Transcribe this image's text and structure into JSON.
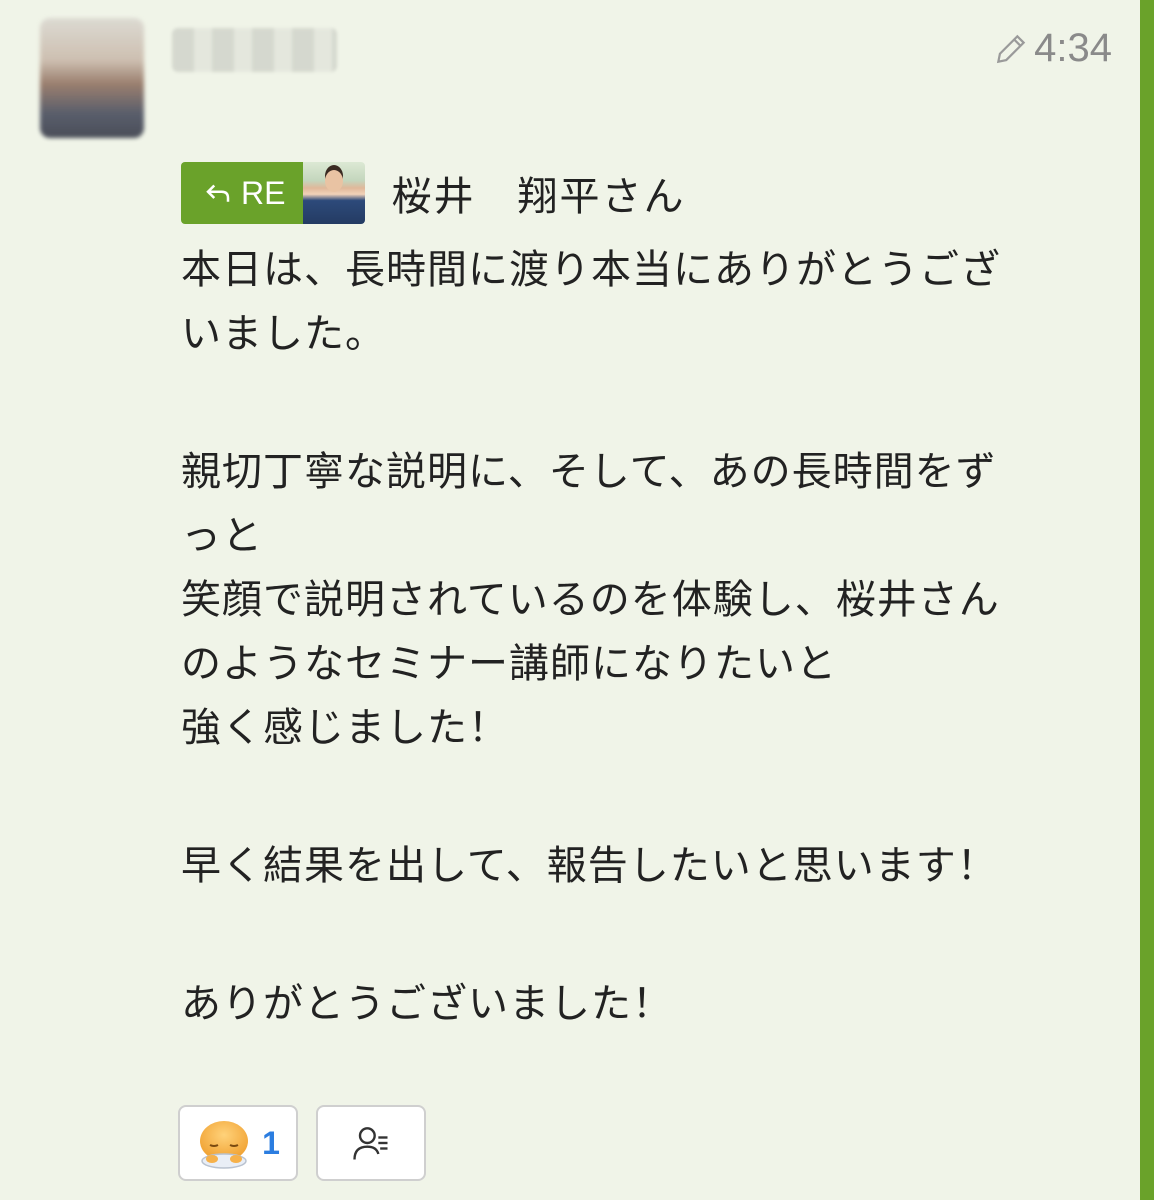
{
  "header": {
    "timestamp": "4:34"
  },
  "reply": {
    "badge_label": "RE",
    "name": "桜井　翔平さん"
  },
  "message": {
    "paragraphs": [
      [
        "本日は、長時間に渡り本当にありがとうござ",
        "いました。"
      ],
      [
        "親切丁寧な説明に、そして、あの長時間をず",
        "っと",
        "笑顔で説明されているのを体験し、桜井さん",
        "のようなセミナー講師になりたいと",
        "強く感じました！"
      ],
      [
        "早く結果を出して、報告したいと思います！"
      ],
      [
        "ありがとうございました！"
      ]
    ]
  },
  "reactions": {
    "emoji_count": "1",
    "emoji_icon": "bowing-face-emoji",
    "readers_icon": "readers-list-icon"
  },
  "colors": {
    "accent": "#6aa22a",
    "background": "#f0f4e8",
    "count": "#2b7de0"
  }
}
